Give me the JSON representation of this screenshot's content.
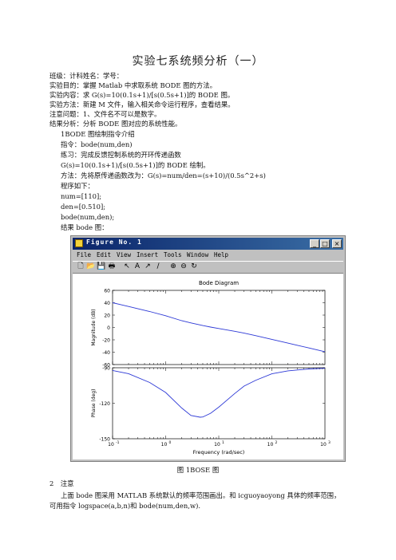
{
  "document": {
    "title": "实验七系统频分析（一）",
    "lines": [
      "班级：计科姓名：学号：",
      "实验目的：掌握 Matlab 中求取系统 BODE 图的方法。",
      "实验内容：求 G(s)=10(0.1s+1)/[s(0.5s+1)]的 BODE 图。",
      "实验方法：新建 M 文件，输入相关命令运行程序，查看结果。",
      "注意问题：1、文件名不可以是数字。",
      "结果分析：分析 BODE 图对应的系统性能。"
    ],
    "indented_lines": [
      "1BODE 图绘制指令介绍",
      "指令：bode(num,den)",
      "练习：完成反馈控制系统的开环传递函数",
      "G(s)=10(0.1s+1)/[s(0.5s+1)]的 BODE 绘制。",
      "方法：先将原传递函数改为：G(s)=num/den=(s+10)/(0.5s^2+s)",
      "程序如下：",
      "num=[110];",
      "den=[0.510];",
      "bode(num,den);",
      "结果 bode 图："
    ],
    "caption": "图 1BOSE 图",
    "note_heading": "2　注意",
    "note_lines": [
      "上面 bode 图采用 MATLAB 系统默认的频率范围画出。和 icguoyaoyong 具体的频率范围，",
      "可用指令 logspace(a,b,n)和 bode(num,den,w)."
    ]
  },
  "figure_window": {
    "title": "Figure No. 1",
    "menu": [
      "File",
      "Edit",
      "View",
      "Insert",
      "Tools",
      "Window",
      "Help"
    ],
    "toolbar_icons": [
      "new-icon",
      "open-icon",
      "save-icon",
      "print-icon",
      "arrow-icon",
      "text-icon",
      "arrow-annotate-icon",
      "line-icon",
      "zoom-in-icon",
      "zoom-out-icon",
      "rotate-icon"
    ]
  },
  "chart_data": [
    {
      "type": "line",
      "title": "Bode Diagram",
      "ylabel": "Magnitude (dB)",
      "xlabel": "",
      "xscale": "log",
      "xlim": [
        0.1,
        1000
      ],
      "ylim": [
        -60,
        60
      ],
      "yticks": [
        -60,
        -40,
        -20,
        0,
        20,
        40,
        60
      ],
      "series_color": "#2d39d6",
      "x": [
        0.1,
        0.2,
        0.5,
        1,
        2,
        3,
        5,
        7,
        10,
        20,
        30,
        50,
        100,
        200,
        300,
        500,
        1000
      ],
      "y": [
        40,
        34,
        25.8,
        19,
        11,
        7.3,
        3.1,
        0.6,
        -1.7,
        -6.2,
        -9.1,
        -13.3,
        -19.2,
        -25.3,
        -28.8,
        -33.2,
        -39.2
      ]
    },
    {
      "type": "line",
      "ylabel": "Phase (deg)",
      "xlabel": "Frequency  (rad/sec)",
      "xscale": "log",
      "xlim": [
        0.1,
        1000
      ],
      "ylim": [
        -150,
        -90
      ],
      "yticks": [
        -150,
        -120,
        -90
      ],
      "xtick_labels": [
        "10-1",
        "100",
        "101",
        "102",
        "103"
      ],
      "series_color": "#2d39d6",
      "x": [
        0.1,
        0.2,
        0.5,
        1,
        2,
        3,
        4.47,
        5,
        7,
        10,
        20,
        30,
        50,
        100,
        200,
        500,
        1000
      ],
      "y": [
        -92.3,
        -95,
        -102.5,
        -110.9,
        -124,
        -130.3,
        -131.8,
        -131.6,
        -128.5,
        -123.3,
        -111.8,
        -105.5,
        -100.5,
        -95.1,
        -92.6,
        -91.0,
        -90.5
      ]
    }
  ]
}
